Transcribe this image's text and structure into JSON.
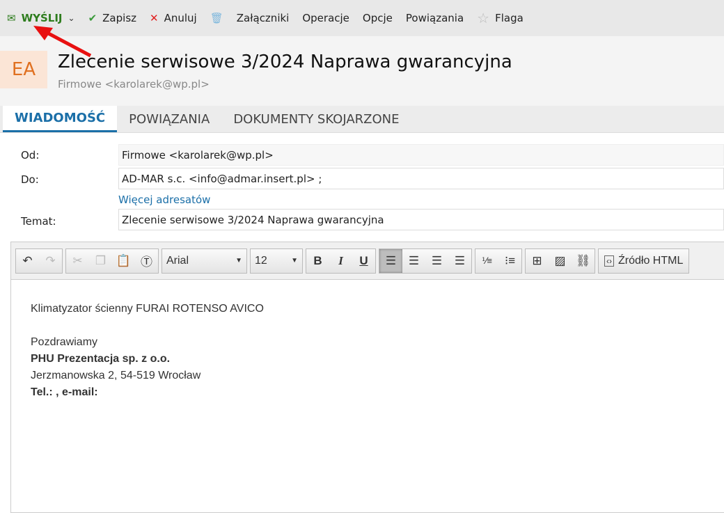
{
  "toolbar": {
    "send": "WYŚLIJ",
    "save": "Zapisz",
    "cancel": "Anuluj",
    "attachments": "Załączniki",
    "operations": "Operacje",
    "options": "Opcje",
    "links": "Powiązania",
    "flag": "Flaga"
  },
  "header": {
    "avatar": "EA",
    "title": "Zlecenie serwisowe 3/2024 Naprawa gwarancyjna",
    "from": "Firmowe <karolarek@wp.pl>"
  },
  "tabs": [
    "WIADOMOŚĆ",
    "POWIĄZANIA",
    "DOKUMENTY SKOJARZONE"
  ],
  "form": {
    "from_label": "Od:",
    "from": "Firmowe <karolarek@wp.pl>",
    "to_label": "Do:",
    "to": "AD-MAR s.c. <info@admar.insert.pl> ;",
    "more": "Więcej adresatów",
    "subject_label": "Temat:",
    "subject": "Zlecenie serwisowe 3/2024 Naprawa gwarancyjna"
  },
  "editor": {
    "font": "Arial",
    "size": "12",
    "source": "Źródło HTML",
    "body": {
      "line1": "Klimatyzator ścienny FURAI ROTENSO AVICO",
      "greet": "Pozdrawiamy",
      "company": "PHU Prezentacja sp. z o.o.",
      "address": "Jerzmanowska 2, 54-519 Wrocław",
      "contact": "Tel.: , e-mail:"
    }
  }
}
